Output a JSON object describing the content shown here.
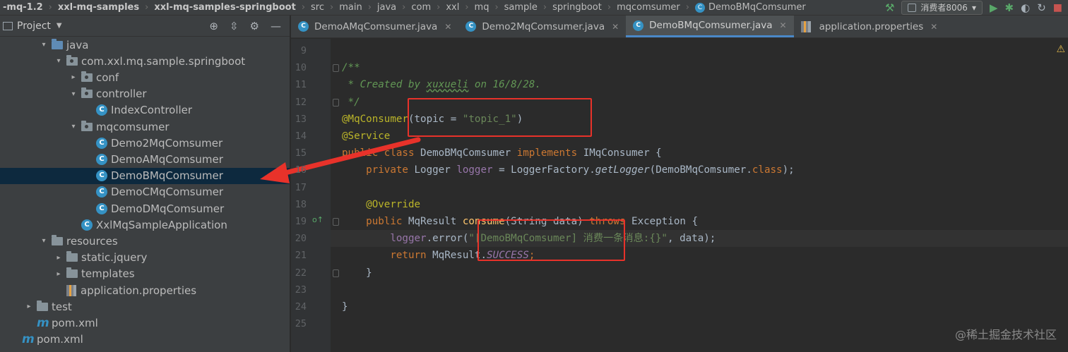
{
  "breadcrumbs": [
    {
      "label": "-mq-1.2",
      "bold": true
    },
    {
      "label": "xxl-mq-samples",
      "bold": true
    },
    {
      "label": "xxl-mq-samples-springboot",
      "bold": true
    },
    {
      "label": "src"
    },
    {
      "label": "main"
    },
    {
      "label": "java"
    },
    {
      "label": "com"
    },
    {
      "label": "xxl"
    },
    {
      "label": "mq"
    },
    {
      "label": "sample"
    },
    {
      "label": "springboot"
    },
    {
      "label": "mqcomsumer"
    },
    {
      "label": "DemoBMqComsumer",
      "class_icon": true
    }
  ],
  "run_config": {
    "label": "消费者8006"
  },
  "project_panel": {
    "title": "Project"
  },
  "tree": [
    {
      "label": "java",
      "indent": 3,
      "arrow": "▾",
      "icon": "src-folder"
    },
    {
      "label": "com.xxl.mq.sample.springboot",
      "indent": 4,
      "arrow": "▾",
      "icon": "package"
    },
    {
      "label": "conf",
      "indent": 5,
      "arrow": "▸",
      "icon": "package"
    },
    {
      "label": "controller",
      "indent": 5,
      "arrow": "▾",
      "icon": "package"
    },
    {
      "label": "IndexController",
      "indent": 6,
      "arrow": "",
      "icon": "class"
    },
    {
      "label": "mqcomsumer",
      "indent": 5,
      "arrow": "▾",
      "icon": "package"
    },
    {
      "label": "Demo2MqComsumer",
      "indent": 6,
      "arrow": "",
      "icon": "class"
    },
    {
      "label": "DemoAMqComsumer",
      "indent": 6,
      "arrow": "",
      "icon": "class"
    },
    {
      "label": "DemoBMqComsumer",
      "indent": 6,
      "arrow": "",
      "icon": "class",
      "selected": true
    },
    {
      "label": "DemoCMqComsumer",
      "indent": 6,
      "arrow": "",
      "icon": "class"
    },
    {
      "label": "DemoDMqComsumer",
      "indent": 6,
      "arrow": "",
      "icon": "class"
    },
    {
      "label": "XxlMqSampleApplication",
      "indent": 5,
      "arrow": "",
      "icon": "class"
    },
    {
      "label": "resources",
      "indent": 3,
      "arrow": "▾",
      "icon": "res-folder"
    },
    {
      "label": "static.jquery",
      "indent": 4,
      "arrow": "▸",
      "icon": "folder"
    },
    {
      "label": "templates",
      "indent": 4,
      "arrow": "▸",
      "icon": "folder"
    },
    {
      "label": "application.properties",
      "indent": 4,
      "arrow": "",
      "icon": "properties"
    },
    {
      "label": "test",
      "indent": 2,
      "arrow": "▸",
      "icon": "folder"
    },
    {
      "label": "pom.xml",
      "indent": 2,
      "arrow": "",
      "icon": "maven"
    },
    {
      "label": "pom.xml",
      "indent": 1,
      "arrow": "",
      "icon": "maven"
    }
  ],
  "tabs": [
    {
      "label": "DemoAMqComsumer.java",
      "icon": "class"
    },
    {
      "label": "Demo2MqComsumer.java",
      "icon": "class"
    },
    {
      "label": "DemoBMqComsumer.java",
      "icon": "class",
      "active": true
    },
    {
      "label": "application.properties",
      "icon": "properties"
    }
  ],
  "code_lines": [
    {
      "num": "9",
      "tokens": []
    },
    {
      "num": "10",
      "tokens": [
        [
          "doc",
          "/**"
        ]
      ]
    },
    {
      "num": "11",
      "tokens": [
        [
          "doc",
          " * Created by "
        ],
        [
          "docu",
          "xuxueli"
        ],
        [
          "doc",
          " on 16/8/28."
        ]
      ]
    },
    {
      "num": "12",
      "tokens": [
        [
          "doc",
          " */"
        ]
      ]
    },
    {
      "num": "13",
      "tokens": [
        [
          "ann",
          "@MqConsumer"
        ],
        [
          "",
          "(topic = "
        ],
        [
          "str",
          "\"topic_1\""
        ],
        [
          "",
          ")"
        ]
      ]
    },
    {
      "num": "14",
      "tokens": [
        [
          "ann",
          "@Service"
        ]
      ]
    },
    {
      "num": "15",
      "tokens": [
        [
          "kw",
          "public class "
        ],
        [
          "",
          "DemoBMqComsumer "
        ],
        [
          "kw",
          "implements "
        ],
        [
          "",
          "IMqConsumer {"
        ]
      ]
    },
    {
      "num": "16",
      "tokens": [
        [
          "",
          "    "
        ],
        [
          "kw",
          "private "
        ],
        [
          "",
          "Logger "
        ],
        [
          "fld",
          "logger"
        ],
        [
          "",
          " = LoggerFactory."
        ],
        [
          "italic",
          "getLogger"
        ],
        [
          "",
          "(DemoBMqComsumer."
        ],
        [
          "kw",
          "class"
        ],
        [
          "",
          ");"
        ]
      ]
    },
    {
      "num": "17",
      "tokens": []
    },
    {
      "num": "18",
      "tokens": [
        [
          "",
          "    "
        ],
        [
          "ann",
          "@Override"
        ]
      ]
    },
    {
      "num": "19",
      "tokens": [
        [
          "",
          "    "
        ],
        [
          "kw",
          "public "
        ],
        [
          "",
          "MqResult "
        ],
        [
          "mth",
          "consume"
        ],
        [
          "",
          "(String data) "
        ],
        [
          "kw",
          "throws "
        ],
        [
          "",
          "Exception {"
        ]
      ]
    },
    {
      "num": "20",
      "tokens": [
        [
          "",
          "        "
        ],
        [
          "fld",
          "logger"
        ],
        [
          "",
          ".error("
        ],
        [
          "str",
          "\"[DemoBMqComsumer] 消费一条消息:{}\""
        ],
        [
          "",
          ", data);"
        ]
      ],
      "current": true
    },
    {
      "num": "21",
      "tokens": [
        [
          "",
          "        "
        ],
        [
          "kw",
          "return "
        ],
        [
          "",
          "MqResult."
        ],
        [
          "fldi",
          "SUCCESS"
        ],
        [
          "kw",
          ";"
        ]
      ]
    },
    {
      "num": "22",
      "tokens": [
        [
          "",
          "    }"
        ]
      ]
    },
    {
      "num": "23",
      "tokens": []
    },
    {
      "num": "24",
      "tokens": [
        [
          "",
          "}"
        ]
      ]
    },
    {
      "num": "25",
      "tokens": []
    }
  ],
  "watermark": "@稀土掘金技术社区"
}
